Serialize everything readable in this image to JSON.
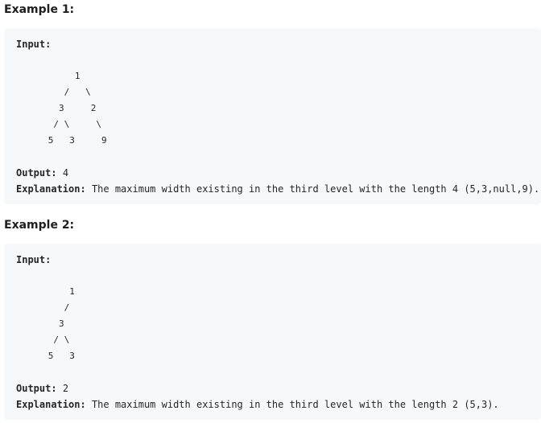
{
  "examples": [
    {
      "heading": "Example 1:",
      "input_label": "Input:",
      "tree": "           1\n         /   \\\n        3     2\n       / \\     \\\n      5   3     9",
      "output_label": "Output:",
      "output_value": "4",
      "explanation_label": "Explanation:",
      "explanation_text": "The maximum width existing in the third level with the length 4 (5,3,null,9)."
    },
    {
      "heading": "Example 2:",
      "input_label": "Input:",
      "tree": "          1\n         /\n        3\n       / \\\n      5   3",
      "output_label": "Output:",
      "output_value": "2",
      "explanation_label": "Explanation:",
      "explanation_text": "The maximum width existing in the third level with the length 2 (5,3)."
    }
  ]
}
